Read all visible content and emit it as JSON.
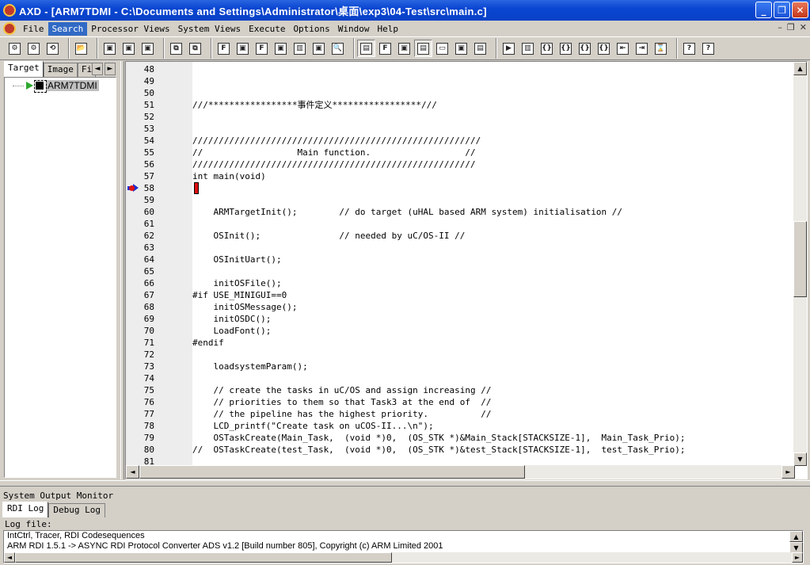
{
  "window": {
    "title": "AXD - [ARM7TDMI - C:\\Documents and Settings\\Administrator\\桌面\\exp3\\04-Test\\src\\main.c]",
    "buttons": {
      "minimize": "_",
      "maximize": "❐",
      "close": "✕"
    }
  },
  "menu": {
    "items": [
      "File",
      "Search",
      "Processor Views",
      "System Views",
      "Execute",
      "Options",
      "Window",
      "Help"
    ],
    "mdi": {
      "minimize": "–",
      "restore": "❐",
      "close": "✕"
    }
  },
  "toolbar": {
    "groups": [
      [
        "⚙",
        "⚙",
        "⟲"
      ],
      [
        "📂"
      ],
      [
        "▣",
        "▣",
        "▣"
      ],
      [
        "⧉",
        "⧉"
      ],
      [
        "F",
        "▣",
        "F",
        "▣",
        "▥",
        "▣",
        "🔍"
      ],
      [
        "▤",
        "F",
        "▣",
        "▤",
        "▭",
        "▣",
        "▤"
      ],
      [
        "▶",
        "▥",
        "{}",
        "{}",
        "{}",
        "{}",
        "⇤",
        "⇥",
        "⌛"
      ],
      [
        "?",
        "?"
      ]
    ]
  },
  "left_panel": {
    "tabs": [
      "Target",
      "Image",
      "Fi"
    ],
    "scroll": [
      "◄",
      "►"
    ],
    "tree_item": "ARM7TDMI"
  },
  "editor": {
    "lines": [
      {
        "n": "48",
        "t": ""
      },
      {
        "n": "49",
        "t": ""
      },
      {
        "n": "50",
        "t": ""
      },
      {
        "n": "51",
        "t": "///*****************事件定义*****************///"
      },
      {
        "n": "52",
        "t": ""
      },
      {
        "n": "53",
        "t": ""
      },
      {
        "n": "54",
        "t": "///////////////////////////////////////////////////////"
      },
      {
        "n": "55",
        "t": "//                  Main function.                  //"
      },
      {
        "n": "56",
        "t": "//////////////////////////////////////////////////////"
      },
      {
        "n": "57",
        "t": "int main(void)"
      },
      {
        "n": "58",
        "t": "",
        "current": true
      },
      {
        "n": "59",
        "t": ""
      },
      {
        "n": "60",
        "t": "    ARMTargetInit();        // do target (uHAL based ARM system) initialisation //"
      },
      {
        "n": "61",
        "t": ""
      },
      {
        "n": "62",
        "t": "    OSInit();               // needed by uC/OS-II //"
      },
      {
        "n": "63",
        "t": ""
      },
      {
        "n": "64",
        "t": "    OSInitUart();"
      },
      {
        "n": "65",
        "t": ""
      },
      {
        "n": "66",
        "t": "    initOSFile();"
      },
      {
        "n": "67",
        "t": "#if USE_MINIGUI==0"
      },
      {
        "n": "68",
        "t": "    initOSMessage();"
      },
      {
        "n": "69",
        "t": "    initOSDC();"
      },
      {
        "n": "70",
        "t": "    LoadFont();"
      },
      {
        "n": "71",
        "t": "#endif"
      },
      {
        "n": "72",
        "t": ""
      },
      {
        "n": "73",
        "t": "    loadsystemParam();"
      },
      {
        "n": "74",
        "t": ""
      },
      {
        "n": "75",
        "t": "    // create the tasks in uC/OS and assign increasing //"
      },
      {
        "n": "76",
        "t": "    // priorities to them so that Task3 at the end of  //"
      },
      {
        "n": "77",
        "t": "    // the pipeline has the highest priority.          //"
      },
      {
        "n": "78",
        "t": "    LCD_printf(\"Create task on uCOS-II...\\n\");"
      },
      {
        "n": "79",
        "t": "    OSTaskCreate(Main_Task,  (void *)0,  (OS_STK *)&Main_Stack[STACKSIZE-1],  Main_Task_Prio);"
      },
      {
        "n": "80",
        "t": "//  OSTaskCreate(test_Task,  (void *)0,  (OS_STK *)&test_Stack[STACKSIZE-1],  test_Task_Prio);"
      },
      {
        "n": "81",
        "t": ""
      }
    ],
    "scroll": {
      "up": "▲",
      "down": "▼",
      "left": "◄",
      "right": "►"
    }
  },
  "output": {
    "title": "System Output Monitor",
    "tabs": [
      "RDI Log",
      "Debug Log"
    ],
    "log_label": "Log file:",
    "log_lines": [
      "IntCtrl, Tracer, RDI Codesequences",
      "ARM RDI 1.5.1 -> ASYNC RDI Protocol Converter ADS v1.2 [Build number 805], Copyright (c) ARM Limited 2001"
    ]
  }
}
